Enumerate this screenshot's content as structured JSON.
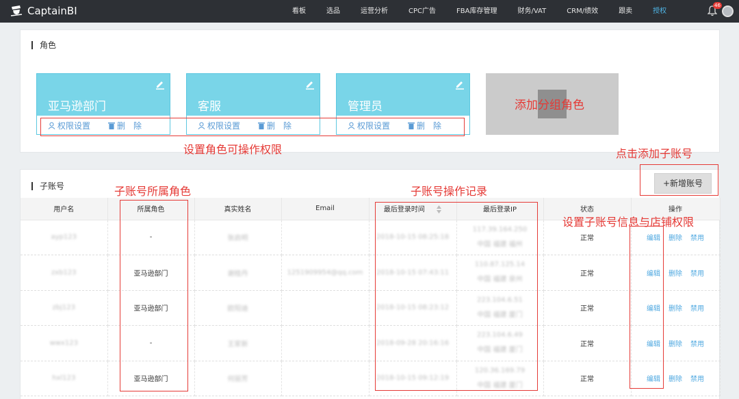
{
  "app": {
    "logo_text": "CaptainBI",
    "notification_count": "46"
  },
  "nav": [
    {
      "label": "看板"
    },
    {
      "label": "选品"
    },
    {
      "label": "运营分析"
    },
    {
      "label": "CPC广告"
    },
    {
      "label": "FBA库存管理"
    },
    {
      "label": "财务/VAT"
    },
    {
      "label": "CRM/绩效"
    },
    {
      "label": "跟卖"
    },
    {
      "label": "授权",
      "active": true
    }
  ],
  "roles_section": {
    "title": "角色",
    "cards": [
      {
        "name": "亚马逊部门",
        "perm_label": "权限设置",
        "delete_label": "删　除"
      },
      {
        "name": "客服",
        "perm_label": "权限设置",
        "delete_label": "删　除"
      },
      {
        "name": "管理员",
        "perm_label": "权限设置",
        "delete_label": "删　除"
      }
    ],
    "add_label": "添加分组角色"
  },
  "annotations": {
    "role_permissions": "设置角色可操作权限",
    "add_sub_account": "点击添加子账号",
    "sub_account_role": "子账号所属角色",
    "operation_log": "子账号操作记录",
    "info_permissions": "设置子账号信息与店铺权限"
  },
  "subaccounts": {
    "title": "子账号",
    "add_button": "+新增账号",
    "columns": [
      "用户名",
      "所属角色",
      "真实姓名",
      "Email",
      "最后登录时间",
      "最后登录IP",
      "状态",
      "操作"
    ],
    "actions": {
      "edit": "编辑",
      "delete": "删除",
      "disable": "禁用"
    },
    "rows": [
      {
        "username": "ayp123",
        "role": "-",
        "realname": "张启明",
        "email": "",
        "last_login": "2018-10-15 08:25:18",
        "ip": "117.39.164.250",
        "location": "中国 福建 福州",
        "status": "正常"
      },
      {
        "username": "zxb123",
        "role": "亚马逊部门",
        "realname": "谢桂丹",
        "email": "1251909954@qq.com",
        "last_login": "2018-10-15 07:43:11",
        "ip": "110.87.125.14",
        "location": "中国 福建 泉州",
        "status": "正常"
      },
      {
        "username": "zbj123",
        "role": "亚马逊部门",
        "realname": "欧阳迪",
        "email": "",
        "last_login": "2018-10-15 08:23:12",
        "ip": "223.104.6.51",
        "location": "中国 福建 厦门",
        "status": "正常"
      },
      {
        "username": "wwx123",
        "role": "-",
        "realname": "王家新",
        "email": "",
        "last_login": "2018-09-28 20:16:16",
        "ip": "223.104.6.49",
        "location": "中国 福建 厦门",
        "status": "正常"
      },
      {
        "username": "hxl123",
        "role": "亚马逊部门",
        "realname": "何丽芳",
        "email": "",
        "last_login": "2018-10-15 09:12:19",
        "ip": "120.36.169.79",
        "location": "中国 福建 厦门",
        "status": "正常"
      }
    ]
  }
}
